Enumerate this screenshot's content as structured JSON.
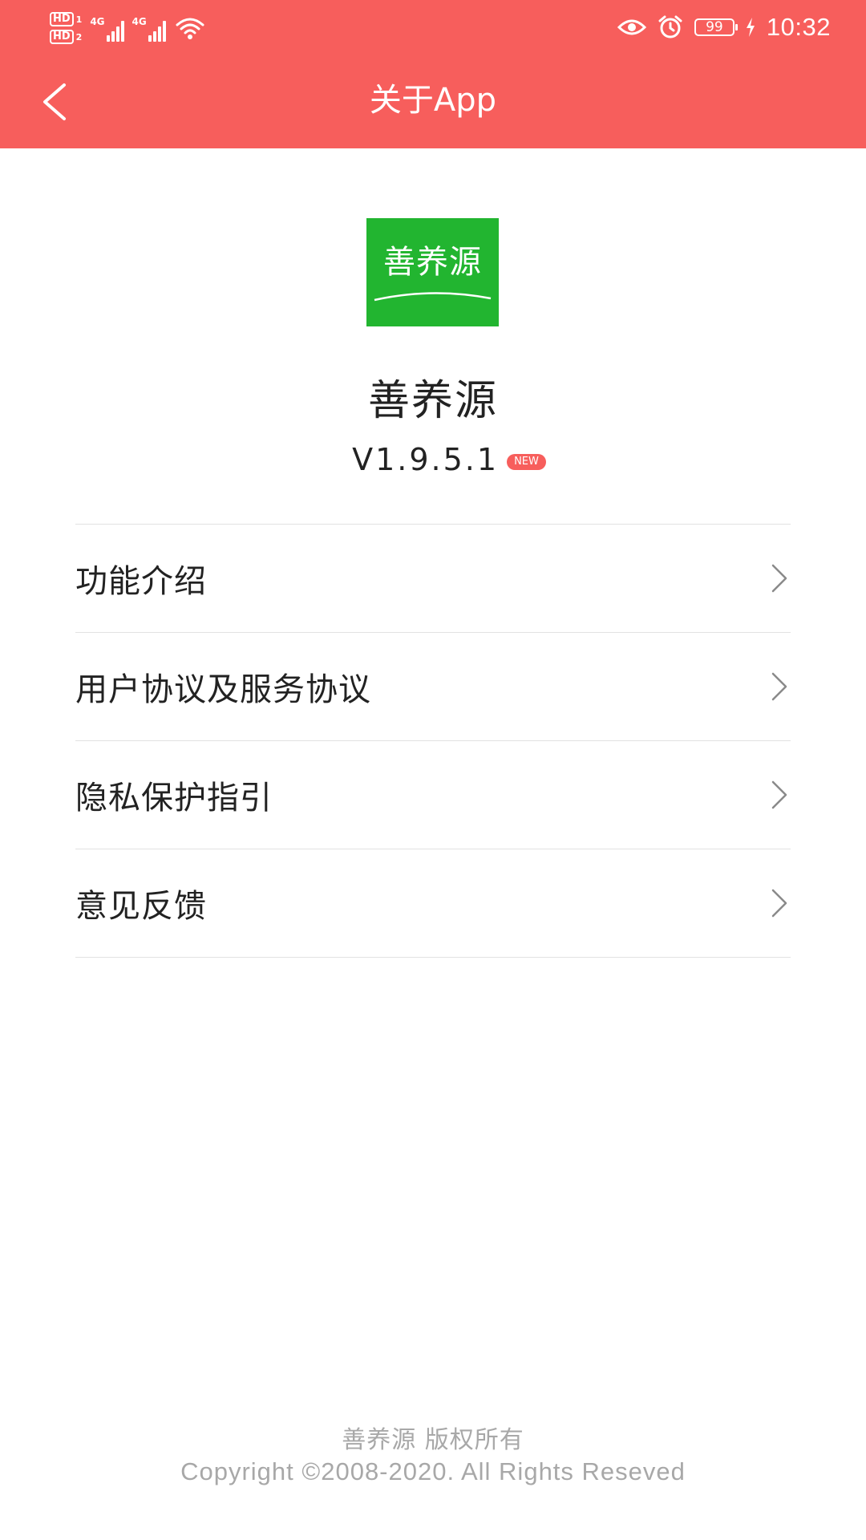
{
  "status_bar": {
    "sim1_label": "HD",
    "sim1_index": "1",
    "sim2_label": "HD",
    "sim2_index": "2",
    "network1": "4G",
    "network2": "4G",
    "battery": "99",
    "time": "10:32"
  },
  "header": {
    "title": "关于App",
    "background": "#F75E5C"
  },
  "app": {
    "logo_text": "善养源",
    "logo_color": "#22B530",
    "name": "善养源",
    "version": "V1.9.5.1",
    "new_badge": "NEW"
  },
  "menu": {
    "items": [
      {
        "label": "功能介绍"
      },
      {
        "label": "用户协议及服务协议"
      },
      {
        "label": "隐私保护指引"
      },
      {
        "label": "意见反馈"
      }
    ]
  },
  "footer": {
    "line1": "善养源 版权所有",
    "line2": "Copyright ©2008-2020. All Rights Reseved"
  }
}
